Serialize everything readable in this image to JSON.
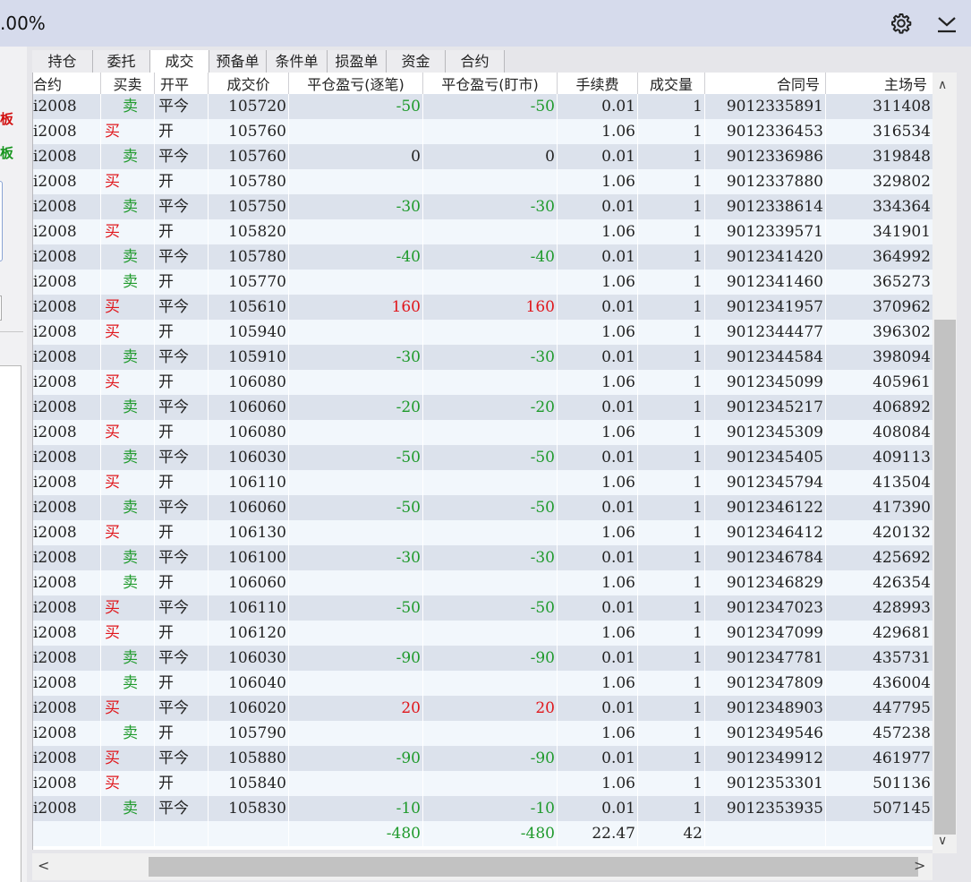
{
  "topbar": {
    "percent": ".00%",
    "gear_icon": "gear-icon",
    "download_icon": "download-icon"
  },
  "leftpanel": {
    "label_red": "板",
    "label_green": "板",
    "arrow": ">I"
  },
  "tabs": [
    "持仓",
    "委托",
    "成交",
    "预备单",
    "条件单",
    "损盈单",
    "资金",
    "合约"
  ],
  "active_tab": 2,
  "columns": [
    "合约",
    "买卖",
    "开平",
    "成交价",
    "平仓盈亏(逐笔)",
    "平仓盈亏(盯市)",
    "手续费",
    "成交量",
    "合同号",
    "主场号"
  ],
  "rows": [
    [
      "i2008",
      "卖",
      "平今",
      "105720",
      "-50",
      "-50",
      "0.01",
      "1",
      "9012335891",
      "311408"
    ],
    [
      "i2008",
      "买",
      "开",
      "105760",
      "",
      "",
      "1.06",
      "1",
      "9012336453",
      "316534"
    ],
    [
      "i2008",
      "卖",
      "平今",
      "105760",
      "0",
      "0",
      "0.01",
      "1",
      "9012336986",
      "319848"
    ],
    [
      "i2008",
      "买",
      "开",
      "105780",
      "",
      "",
      "1.06",
      "1",
      "9012337880",
      "329802"
    ],
    [
      "i2008",
      "卖",
      "平今",
      "105750",
      "-30",
      "-30",
      "0.01",
      "1",
      "9012338614",
      "334364"
    ],
    [
      "i2008",
      "买",
      "开",
      "105820",
      "",
      "",
      "1.06",
      "1",
      "9012339571",
      "341901"
    ],
    [
      "i2008",
      "卖",
      "平今",
      "105780",
      "-40",
      "-40",
      "0.01",
      "1",
      "9012341420",
      "364992"
    ],
    [
      "i2008",
      "卖",
      "开",
      "105770",
      "",
      "",
      "1.06",
      "1",
      "9012341460",
      "365273"
    ],
    [
      "i2008",
      "买",
      "平今",
      "105610",
      "160",
      "160",
      "0.01",
      "1",
      "9012341957",
      "370962"
    ],
    [
      "i2008",
      "买",
      "开",
      "105940",
      "",
      "",
      "1.06",
      "1",
      "9012344477",
      "396302"
    ],
    [
      "i2008",
      "卖",
      "平今",
      "105910",
      "-30",
      "-30",
      "0.01",
      "1",
      "9012344584",
      "398094"
    ],
    [
      "i2008",
      "买",
      "开",
      "106080",
      "",
      "",
      "1.06",
      "1",
      "9012345099",
      "405961"
    ],
    [
      "i2008",
      "卖",
      "平今",
      "106060",
      "-20",
      "-20",
      "0.01",
      "1",
      "9012345217",
      "406892"
    ],
    [
      "i2008",
      "买",
      "开",
      "106080",
      "",
      "",
      "1.06",
      "1",
      "9012345309",
      "408084"
    ],
    [
      "i2008",
      "卖",
      "平今",
      "106030",
      "-50",
      "-50",
      "0.01",
      "1",
      "9012345405",
      "409113"
    ],
    [
      "i2008",
      "买",
      "开",
      "106110",
      "",
      "",
      "1.06",
      "1",
      "9012345794",
      "413504"
    ],
    [
      "i2008",
      "卖",
      "平今",
      "106060",
      "-50",
      "-50",
      "0.01",
      "1",
      "9012346122",
      "417390"
    ],
    [
      "i2008",
      "买",
      "开",
      "106130",
      "",
      "",
      "1.06",
      "1",
      "9012346412",
      "420132"
    ],
    [
      "i2008",
      "卖",
      "平今",
      "106100",
      "-30",
      "-30",
      "0.01",
      "1",
      "9012346784",
      "425692"
    ],
    [
      "i2008",
      "卖",
      "开",
      "106060",
      "",
      "",
      "1.06",
      "1",
      "9012346829",
      "426354"
    ],
    [
      "i2008",
      "买",
      "平今",
      "106110",
      "-50",
      "-50",
      "0.01",
      "1",
      "9012347023",
      "428993"
    ],
    [
      "i2008",
      "买",
      "开",
      "106120",
      "",
      "",
      "1.06",
      "1",
      "9012347099",
      "429681"
    ],
    [
      "i2008",
      "卖",
      "平今",
      "106030",
      "-90",
      "-90",
      "0.01",
      "1",
      "9012347781",
      "435731"
    ],
    [
      "i2008",
      "卖",
      "开",
      "106040",
      "",
      "",
      "1.06",
      "1",
      "9012347809",
      "436004"
    ],
    [
      "i2008",
      "买",
      "平今",
      "106020",
      "20",
      "20",
      "0.01",
      "1",
      "9012348903",
      "447795"
    ],
    [
      "i2008",
      "卖",
      "开",
      "105790",
      "",
      "",
      "1.06",
      "1",
      "9012349546",
      "457238"
    ],
    [
      "i2008",
      "买",
      "平今",
      "105880",
      "-90",
      "-90",
      "0.01",
      "1",
      "9012349912",
      "461977"
    ],
    [
      "i2008",
      "买",
      "开",
      "105840",
      "",
      "",
      "1.06",
      "1",
      "9012353301",
      "501136"
    ],
    [
      "i2008",
      "卖",
      "平今",
      "105830",
      "-10",
      "-10",
      "0.01",
      "1",
      "9012353935",
      "507145"
    ]
  ],
  "totals": [
    "",
    "",
    "",
    "",
    "-480",
    "-480",
    "22.47",
    "42",
    "",
    ""
  ],
  "scroll": {
    "up": "∧",
    "down": "∨",
    "left": "<",
    "right": ">"
  },
  "colors": {
    "buy": "#e0161b",
    "sell": "#1f9a2c",
    "row_odd": "#dce2ec",
    "row_even": "#f2f7fc"
  }
}
